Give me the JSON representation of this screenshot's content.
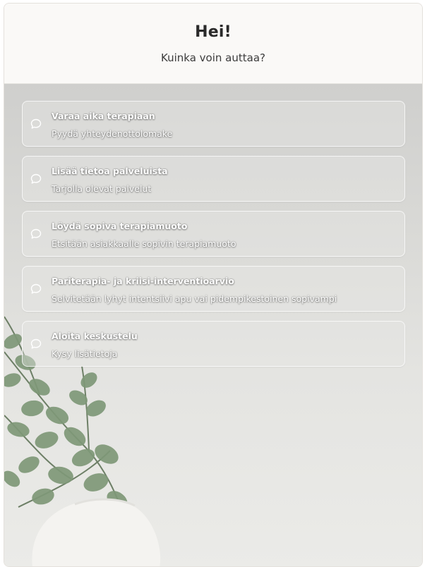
{
  "header": {
    "title": "Hei!",
    "subtitle": "Kuinka voin auttaa?"
  },
  "options": [
    {
      "title": "Varaa aika terapiaan",
      "subtitle": "Pyydä yhteydenottolomake",
      "icon": "chat-bubble-icon"
    },
    {
      "title": "Lisää tietoa palveluista",
      "subtitle": "Tarjolla olevat palvelut",
      "icon": "chat-bubble-icon"
    },
    {
      "title": "Löydä sopiva terapiamuoto",
      "subtitle": "Etsitään asiakkaalle sopivin terapiamuoto",
      "icon": "chat-bubble-icon"
    },
    {
      "title": "Pariterapia- ja kriisi-interventioarvio",
      "subtitle": "Selvitetään lyhyt intentsiivi apu vai pidempikestoinen sopivampi",
      "icon": "chat-bubble-icon"
    },
    {
      "title": "Aloita keskustelu",
      "subtitle": "Kysy lisätietoja",
      "icon": "chat-bubble-icon"
    }
  ],
  "colors": {
    "header_bg": "#faf9f7",
    "title_text": "#2a2a2a",
    "option_text": "#ffffff",
    "leaf_green": "#7f9878",
    "vase_white": "#f4f3f0"
  }
}
